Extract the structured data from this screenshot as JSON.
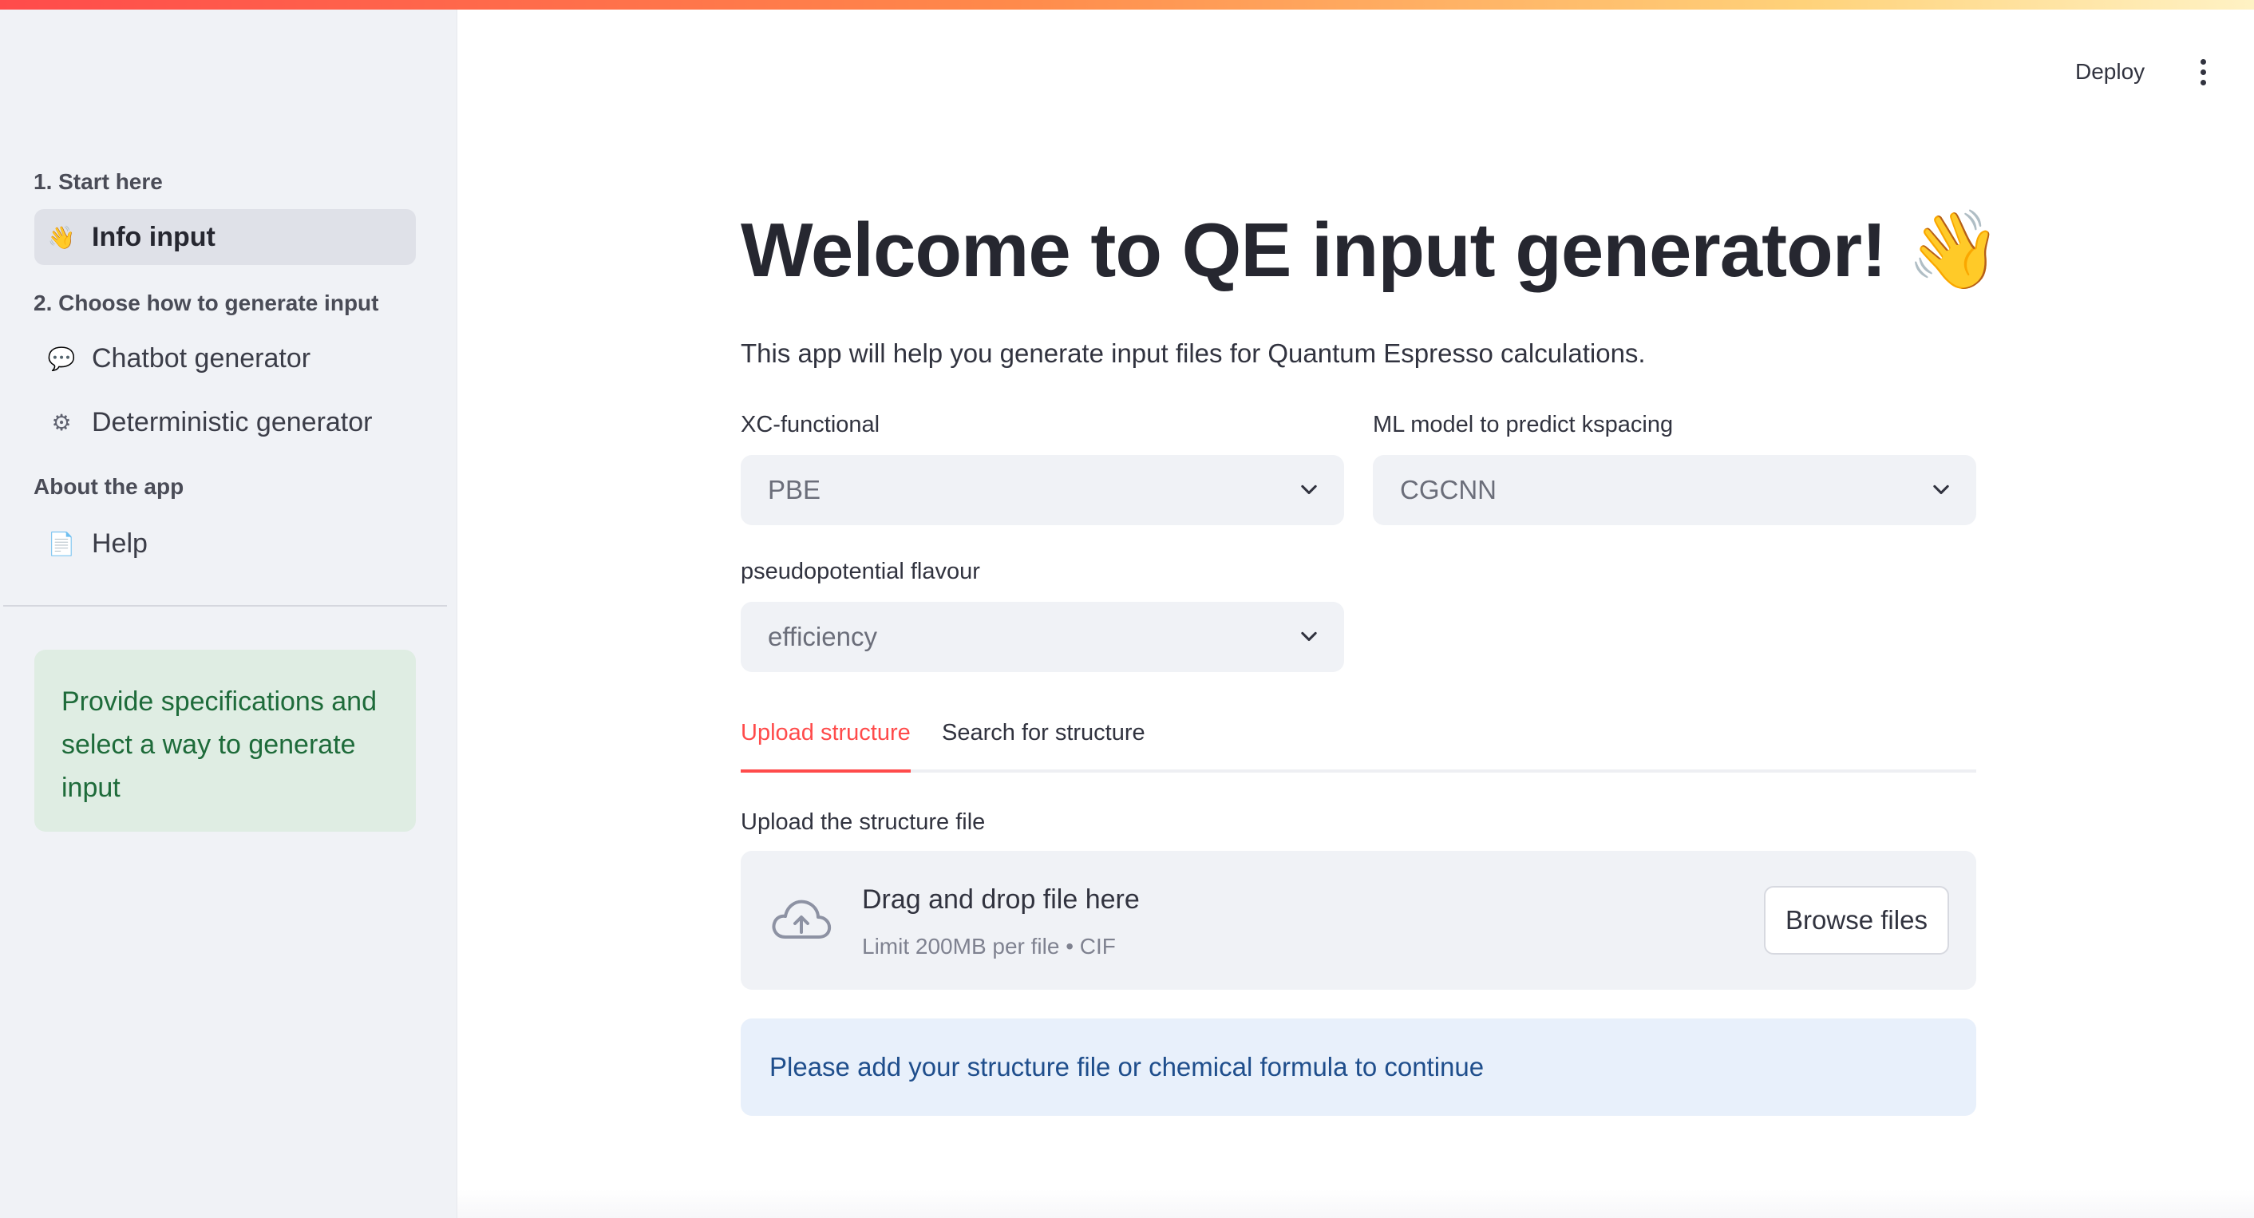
{
  "header": {
    "deploy_label": "Deploy",
    "menu_icon": "more-vertical-icon"
  },
  "sidebar": {
    "sections": [
      {
        "heading": "1. Start here",
        "items": [
          {
            "icon": "👋",
            "icon_name": "waving-hand-icon",
            "label": "Info input",
            "active": true
          }
        ]
      },
      {
        "heading": "2. Choose how to generate input",
        "items": [
          {
            "icon": "💬",
            "icon_name": "speech-bubble-icon",
            "label": "Chatbot generator",
            "active": false
          },
          {
            "icon": "⚙",
            "icon_name": "gear-icon",
            "label": "Deterministic generator",
            "active": false
          }
        ]
      },
      {
        "heading": "About the app",
        "items": [
          {
            "icon": "📄",
            "icon_name": "document-icon",
            "label": "Help",
            "active": false
          }
        ]
      }
    ],
    "message": "Provide specifications and select a way to generate input"
  },
  "main": {
    "title": "Welcome to QE input generator! 👋",
    "subtitle": "This app will help you generate input files for Quantum Espresso calculations.",
    "xc_functional": {
      "label": "XC-functional",
      "value": "PBE"
    },
    "ml_model": {
      "label": "ML model to predict kspacing",
      "value": "CGCNN"
    },
    "pseudopotential": {
      "label": "pseudopotential flavour",
      "value": "efficiency"
    },
    "tabs": [
      {
        "label": "Upload structure",
        "active": true
      },
      {
        "label": "Search for structure",
        "active": false
      }
    ],
    "upload": {
      "label": "Upload the structure file",
      "drop_title": "Drag and drop file here",
      "drop_limit": "Limit 200MB per file • CIF",
      "browse_label": "Browse files"
    },
    "info_message": "Please add your structure file or chemical formula to continue"
  },
  "colors": {
    "accent": "#ff4b4b",
    "sidebar_bg": "#f0f2f6",
    "success_bg": "#dfede3",
    "success_text": "#1e6b3a",
    "info_bg": "#e8f0fb",
    "info_text": "#1f4e8c"
  }
}
